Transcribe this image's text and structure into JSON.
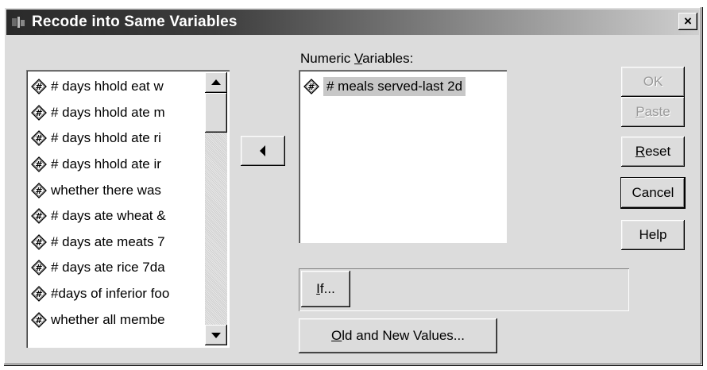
{
  "window": {
    "title": "Recode into Same Variables",
    "close_label": "×"
  },
  "source_list": {
    "items": [
      {
        "label": "# days hhold eat w",
        "icon": "numeric-variable-icon"
      },
      {
        "label": "# days hhold ate m",
        "icon": "numeric-variable-icon"
      },
      {
        "label": "# days hhold ate ri",
        "icon": "numeric-variable-icon"
      },
      {
        "label": "# days hhold ate ir",
        "icon": "numeric-variable-icon"
      },
      {
        "label": "whether there was",
        "icon": "numeric-variable-icon"
      },
      {
        "label": "# days ate wheat &",
        "icon": "numeric-variable-icon"
      },
      {
        "label": "# days ate meats 7",
        "icon": "numeric-variable-icon"
      },
      {
        "label": "# days ate rice 7da",
        "icon": "numeric-variable-icon"
      },
      {
        "label": "#days of inferior foo",
        "icon": "numeric-variable-icon"
      },
      {
        "label": "whether all membe",
        "icon": "numeric-variable-icon"
      }
    ]
  },
  "numeric_variables": {
    "label_pre": "Numeric ",
    "label_mnemonic": "V",
    "label_post": "ariables:",
    "items": [
      {
        "label": "# meals served-last 2d",
        "icon": "numeric-variable-icon"
      }
    ]
  },
  "buttons": {
    "ok": "OK",
    "paste_mnemonic": "P",
    "paste_rest": "aste",
    "reset_mnemonic": "R",
    "reset_rest": "eset",
    "cancel": "Cancel",
    "help": "Help",
    "if_mnemonic": "I",
    "if_rest": "f...",
    "old_new_mnemonic": "O",
    "old_new_rest": "ld and New Values..."
  },
  "colors": {
    "dialog_bg": "#dcdcdc",
    "selection": "#c7c7c7"
  }
}
